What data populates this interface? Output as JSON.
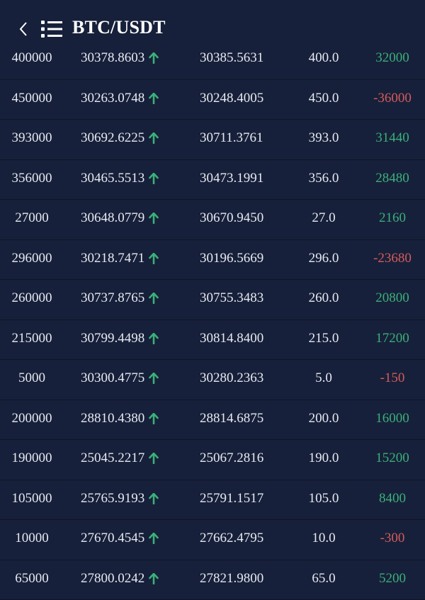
{
  "header": {
    "title": "BTC/USDT"
  },
  "colors": {
    "background": "#17203a",
    "positive": "#3bb07a",
    "negative": "#d45b5b",
    "arrow": "#3bb07a"
  },
  "rows": [
    {
      "amount": "400000",
      "open": "30378.8603",
      "close": "30385.5631",
      "qty": "400.0",
      "pnl": "32000",
      "pnl_sign": "pos"
    },
    {
      "amount": "450000",
      "open": "30263.0748",
      "close": "30248.4005",
      "qty": "450.0",
      "pnl": "-36000",
      "pnl_sign": "neg"
    },
    {
      "amount": "393000",
      "open": "30692.6225",
      "close": "30711.3761",
      "qty": "393.0",
      "pnl": "31440",
      "pnl_sign": "pos"
    },
    {
      "amount": "356000",
      "open": "30465.5513",
      "close": "30473.1991",
      "qty": "356.0",
      "pnl": "28480",
      "pnl_sign": "pos"
    },
    {
      "amount": "27000",
      "open": "30648.0779",
      "close": "30670.9450",
      "qty": "27.0",
      "pnl": "2160",
      "pnl_sign": "pos"
    },
    {
      "amount": "296000",
      "open": "30218.7471",
      "close": "30196.5669",
      "qty": "296.0",
      "pnl": "-23680",
      "pnl_sign": "neg"
    },
    {
      "amount": "260000",
      "open": "30737.8765",
      "close": "30755.3483",
      "qty": "260.0",
      "pnl": "20800",
      "pnl_sign": "pos"
    },
    {
      "amount": "215000",
      "open": "30799.4498",
      "close": "30814.8400",
      "qty": "215.0",
      "pnl": "17200",
      "pnl_sign": "pos"
    },
    {
      "amount": "5000",
      "open": "30300.4775",
      "close": "30280.2363",
      "qty": "5.0",
      "pnl": "-150",
      "pnl_sign": "neg"
    },
    {
      "amount": "200000",
      "open": "28810.4380",
      "close": "28814.6875",
      "qty": "200.0",
      "pnl": "16000",
      "pnl_sign": "pos"
    },
    {
      "amount": "190000",
      "open": "25045.2217",
      "close": "25067.2816",
      "qty": "190.0",
      "pnl": "15200",
      "pnl_sign": "pos"
    },
    {
      "amount": "105000",
      "open": "25765.9193",
      "close": "25791.1517",
      "qty": "105.0",
      "pnl": "8400",
      "pnl_sign": "pos"
    },
    {
      "amount": "10000",
      "open": "27670.4545",
      "close": "27662.4795",
      "qty": "10.0",
      "pnl": "-300",
      "pnl_sign": "neg"
    },
    {
      "amount": "65000",
      "open": "27800.0242",
      "close": "27821.9800",
      "qty": "65.0",
      "pnl": "5200",
      "pnl_sign": "pos"
    }
  ]
}
